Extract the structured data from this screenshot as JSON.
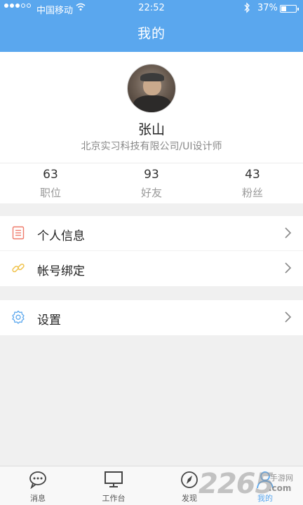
{
  "status_bar": {
    "carrier": "中国移动",
    "time": "22:52",
    "battery": "37%",
    "battery_level": 0.37
  },
  "nav": {
    "title": "我的"
  },
  "profile": {
    "name": "张山",
    "subtitle": "北京实习科技有限公司/UI设计师"
  },
  "stats": [
    {
      "value": "63",
      "label": "职位"
    },
    {
      "value": "93",
      "label": "好友"
    },
    {
      "value": "43",
      "label": "粉丝"
    }
  ],
  "menu": {
    "personal_info": "个人信息",
    "account_binding": "帐号绑定",
    "settings": "设置"
  },
  "tabs": [
    {
      "label": "消息"
    },
    {
      "label": "工作台"
    },
    {
      "label": "发现"
    },
    {
      "label": "我的"
    }
  ],
  "watermark": {
    "number": "2265",
    "site": "手游网",
    "domain": ".com"
  },
  "colors": {
    "accent": "#5aa7ee",
    "info_icon": "#ef7a6a",
    "link_icon": "#f0c24a",
    "settings_icon": "#5aa7ee"
  }
}
